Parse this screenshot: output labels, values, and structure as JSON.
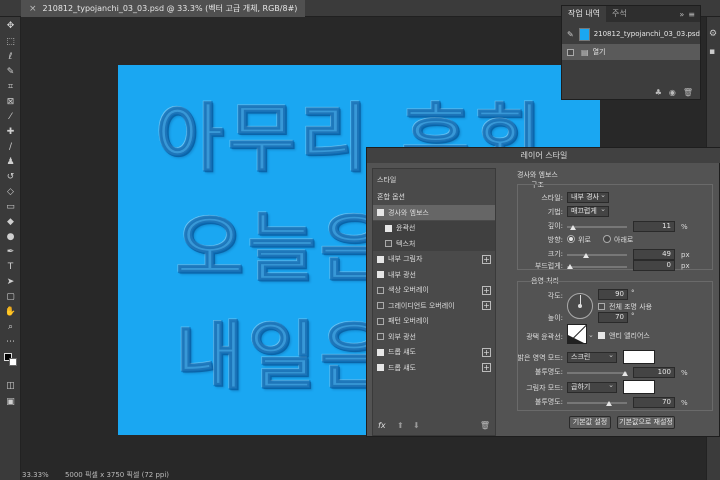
{
  "document": {
    "tab_title": "210812_typojanchi_03_03.psd @ 33.3% (벡터 고급 개체, RGB/8#)",
    "zoom": "33.33%",
    "status": "5000 픽셀 x 3750 픽셀 (72 ppi)"
  },
  "canvas": {
    "background": "#1aa7f2",
    "lines": [
      "아무리 후회",
      "오늘은",
      "내일은"
    ]
  },
  "history_panel": {
    "tabs": [
      "작업 내역",
      "주석"
    ],
    "snapshot_label": "210812_typojanchi_03_03.psd",
    "steps": [
      "열기"
    ]
  },
  "layer_style": {
    "title": "레이어 스타일",
    "list_header": "스타일",
    "blending_options": "혼합 옵션",
    "items": [
      {
        "label": "경사와 엠보스",
        "checked": true,
        "selected": true,
        "plus": false
      },
      {
        "label": "윤곽선",
        "checked": true,
        "sub": true,
        "plus": false
      },
      {
        "label": "텍스처",
        "checked": false,
        "sub": true,
        "plus": false
      },
      {
        "label": "내부 그림자",
        "checked": true,
        "plus": true
      },
      {
        "label": "내부 광선",
        "checked": true,
        "plus": false
      },
      {
        "label": "색상 오버레이",
        "checked": false,
        "plus": true
      },
      {
        "label": "그레이디언트 오버레이",
        "checked": false,
        "plus": true
      },
      {
        "label": "패턴 오버레이",
        "checked": false,
        "plus": false
      },
      {
        "label": "외부 광선",
        "checked": false,
        "plus": false
      },
      {
        "label": "드롭 섀도",
        "checked": true,
        "plus": true
      },
      {
        "label": "드롭 섀도",
        "checked": true,
        "plus": true
      }
    ],
    "fx_label": "fx",
    "section_title": "경사와 엠보스",
    "structure": {
      "heading": "구조",
      "style_label": "스타일:",
      "style_value": "내부 경사",
      "technique_label": "기법:",
      "technique_value": "매끄럽게",
      "depth_label": "깊이:",
      "depth_value": "11",
      "depth_unit": "%",
      "direction_label": "방향:",
      "direction_up": "위로",
      "direction_down": "아래로",
      "size_label": "크기:",
      "size_value": "49",
      "size_unit": "px",
      "soften_label": "부드럽게:",
      "soften_value": "0",
      "soften_unit": "px"
    },
    "shading": {
      "heading": "음영 처리",
      "angle_label": "각도:",
      "angle_value": "90",
      "angle_unit": "°",
      "global_light": "전체 조명 사용",
      "altitude_label": "높이:",
      "altitude_value": "70",
      "altitude_unit": "°",
      "gloss_label": "광택 윤곽선:",
      "anti_alias": "앤티 앨리어스",
      "highlight_label": "밝은 영역 모드:",
      "highlight_mode": "스크린",
      "highlight_opacity_label": "불투명도:",
      "highlight_opacity": "100",
      "shadow_label": "그림자 모드:",
      "shadow_mode": "곱하기",
      "shadow_opacity_label": "불투명도:",
      "shadow_opacity": "70",
      "percent": "%"
    },
    "make_default": "기본값 설정",
    "reset_default": "기본값으로 재설정"
  }
}
